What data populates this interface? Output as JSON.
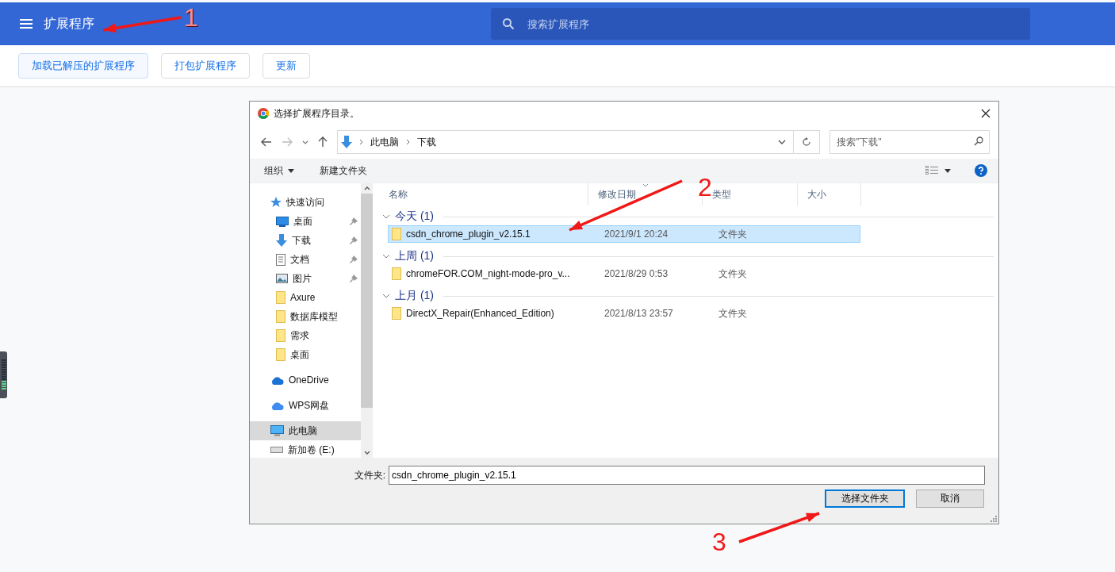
{
  "header": {
    "title": "扩展程序",
    "search": {
      "placeholder": "搜索扩展程序"
    }
  },
  "toolbar": [
    {
      "label": "加载已解压的扩展程序",
      "kind": "primary"
    },
    {
      "label": "打包扩展程序",
      "kind": "normal"
    },
    {
      "label": "更新",
      "kind": "normal"
    }
  ],
  "dialog": {
    "title": "选择扩展程序目录。",
    "breadcrumb": [
      "此电脑",
      "下载"
    ],
    "search": {
      "placeholder": "搜索\"下载\""
    },
    "commands": [
      {
        "label": "组织",
        "dropdown": true
      },
      {
        "label": "新建文件夹",
        "dropdown": false
      }
    ],
    "nav": [
      {
        "label": "快速访问",
        "kind": "star",
        "pinned": false,
        "selected": false
      },
      {
        "label": "桌面",
        "kind": "desktop",
        "pinned": true,
        "selected": false
      },
      {
        "label": "下载",
        "kind": "download",
        "pinned": true,
        "selected": false
      },
      {
        "label": "文档",
        "kind": "document",
        "pinned": true,
        "selected": false
      },
      {
        "label": "图片",
        "kind": "picture",
        "pinned": true,
        "selected": false
      },
      {
        "label": "Axure",
        "kind": "folder",
        "pinned": false,
        "selected": false
      },
      {
        "label": "数据库模型",
        "kind": "folder",
        "pinned": false,
        "selected": false
      },
      {
        "label": "需求",
        "kind": "folder",
        "pinned": false,
        "selected": false
      },
      {
        "label": "桌面",
        "kind": "folder",
        "pinned": false,
        "selected": false
      },
      {
        "label": "OneDrive",
        "kind": "onedrive",
        "pinned": false,
        "selected": false
      },
      {
        "label": "WPS网盘",
        "kind": "cloud",
        "pinned": false,
        "selected": false
      },
      {
        "label": "此电脑",
        "kind": "pc",
        "pinned": false,
        "selected": true
      },
      {
        "label": "新加卷 (E:)",
        "kind": "drive",
        "pinned": false,
        "selected": false
      }
    ],
    "columns": [
      {
        "label": "名称",
        "sorted": false
      },
      {
        "label": "修改日期",
        "sorted": true
      },
      {
        "label": "类型",
        "sorted": false
      },
      {
        "label": "大小",
        "sorted": false
      }
    ],
    "groups": [
      {
        "label": "今天 (1)",
        "expanded": true,
        "files": [
          {
            "name": "csdn_chrome_plugin_v2.15.1",
            "date": "2021/9/1 20:24",
            "type": "文件夹",
            "selected": true
          }
        ]
      },
      {
        "label": "上周 (1)",
        "expanded": true,
        "files": [
          {
            "name": "chromeFOR.COM_night-mode-pro_v...",
            "date": "2021/8/29 0:53",
            "type": "文件夹",
            "selected": false
          }
        ]
      },
      {
        "label": "上月 (1)",
        "expanded": true,
        "files": [
          {
            "name": "DirectX_Repair(Enhanced_Edition)",
            "date": "2021/8/13 23:57",
            "type": "文件夹",
            "selected": false
          }
        ]
      }
    ],
    "folder_label": "文件夹:",
    "folder_value": "csdn_chrome_plugin_v2.15.1",
    "buttons": [
      {
        "label": "选择文件夹",
        "kind": "primary"
      },
      {
        "label": "取消",
        "kind": "normal"
      }
    ]
  },
  "annotations": [
    {
      "label": "1"
    },
    {
      "label": "2"
    },
    {
      "label": "3"
    }
  ]
}
